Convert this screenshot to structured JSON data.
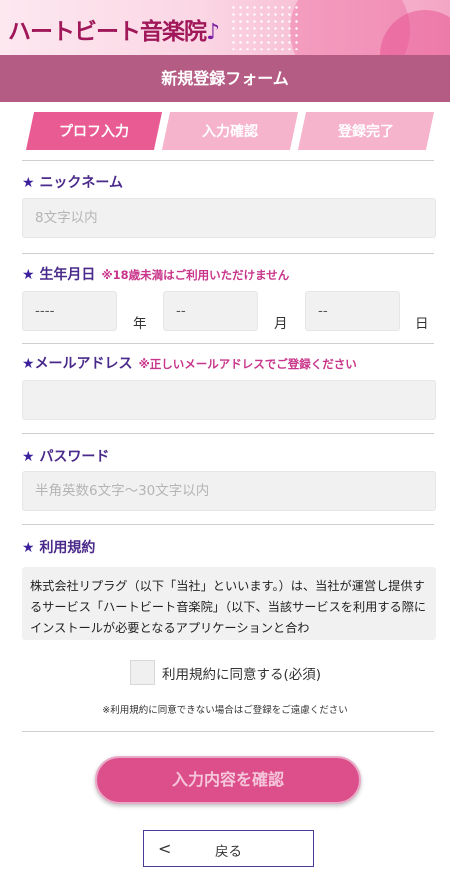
{
  "header": {
    "logo_text": "ハートビート音楽院",
    "logo_icon": "music-note-icon"
  },
  "titlebar": {
    "title": "新規登録フォーム"
  },
  "steps": [
    {
      "label": "プロフ入力",
      "active": true
    },
    {
      "label": "入力確認",
      "active": false
    },
    {
      "label": "登録完了",
      "active": false
    }
  ],
  "nickname": {
    "star": "★",
    "label": "ニックネーム",
    "placeholder": "8文字以内"
  },
  "birthday": {
    "star": "★",
    "label": "生年月日",
    "note": "※18歳未満はご利用いただけません",
    "year_value": "----",
    "year_unit": "年",
    "month_value": "--",
    "month_unit": "月",
    "day_value": "--",
    "day_unit": "日"
  },
  "email": {
    "star": "★",
    "label": "メールアドレス",
    "note": "※正しいメールアドレスでご登録ください",
    "value": ""
  },
  "password": {
    "star": "★",
    "label": "パスワード",
    "placeholder": "半角英数6文字〜30文字以内"
  },
  "terms": {
    "star": "★",
    "label": "利用規約",
    "text": "株式会社リプラグ（以下「当社」といいます。）は、当社が運営し提供するサービス「ハートビート音楽院」（以下、当該サービスを利用する際にインストールが必要となるアプリケーションと合わ"
  },
  "agree": {
    "label": "利用規約に同意する(必須)",
    "checked": false,
    "note": "※利用規約に同意できない場合はご登録をご遠慮ください"
  },
  "buttons": {
    "confirm": "入力内容を確認",
    "back": "戻る",
    "back_icon": "chevron-left-icon"
  },
  "colors": {
    "accent_pink": "#e95b93",
    "titlebar": "#b55c84",
    "label_purple": "#4a2a8a",
    "note_pink": "#c9358a"
  }
}
